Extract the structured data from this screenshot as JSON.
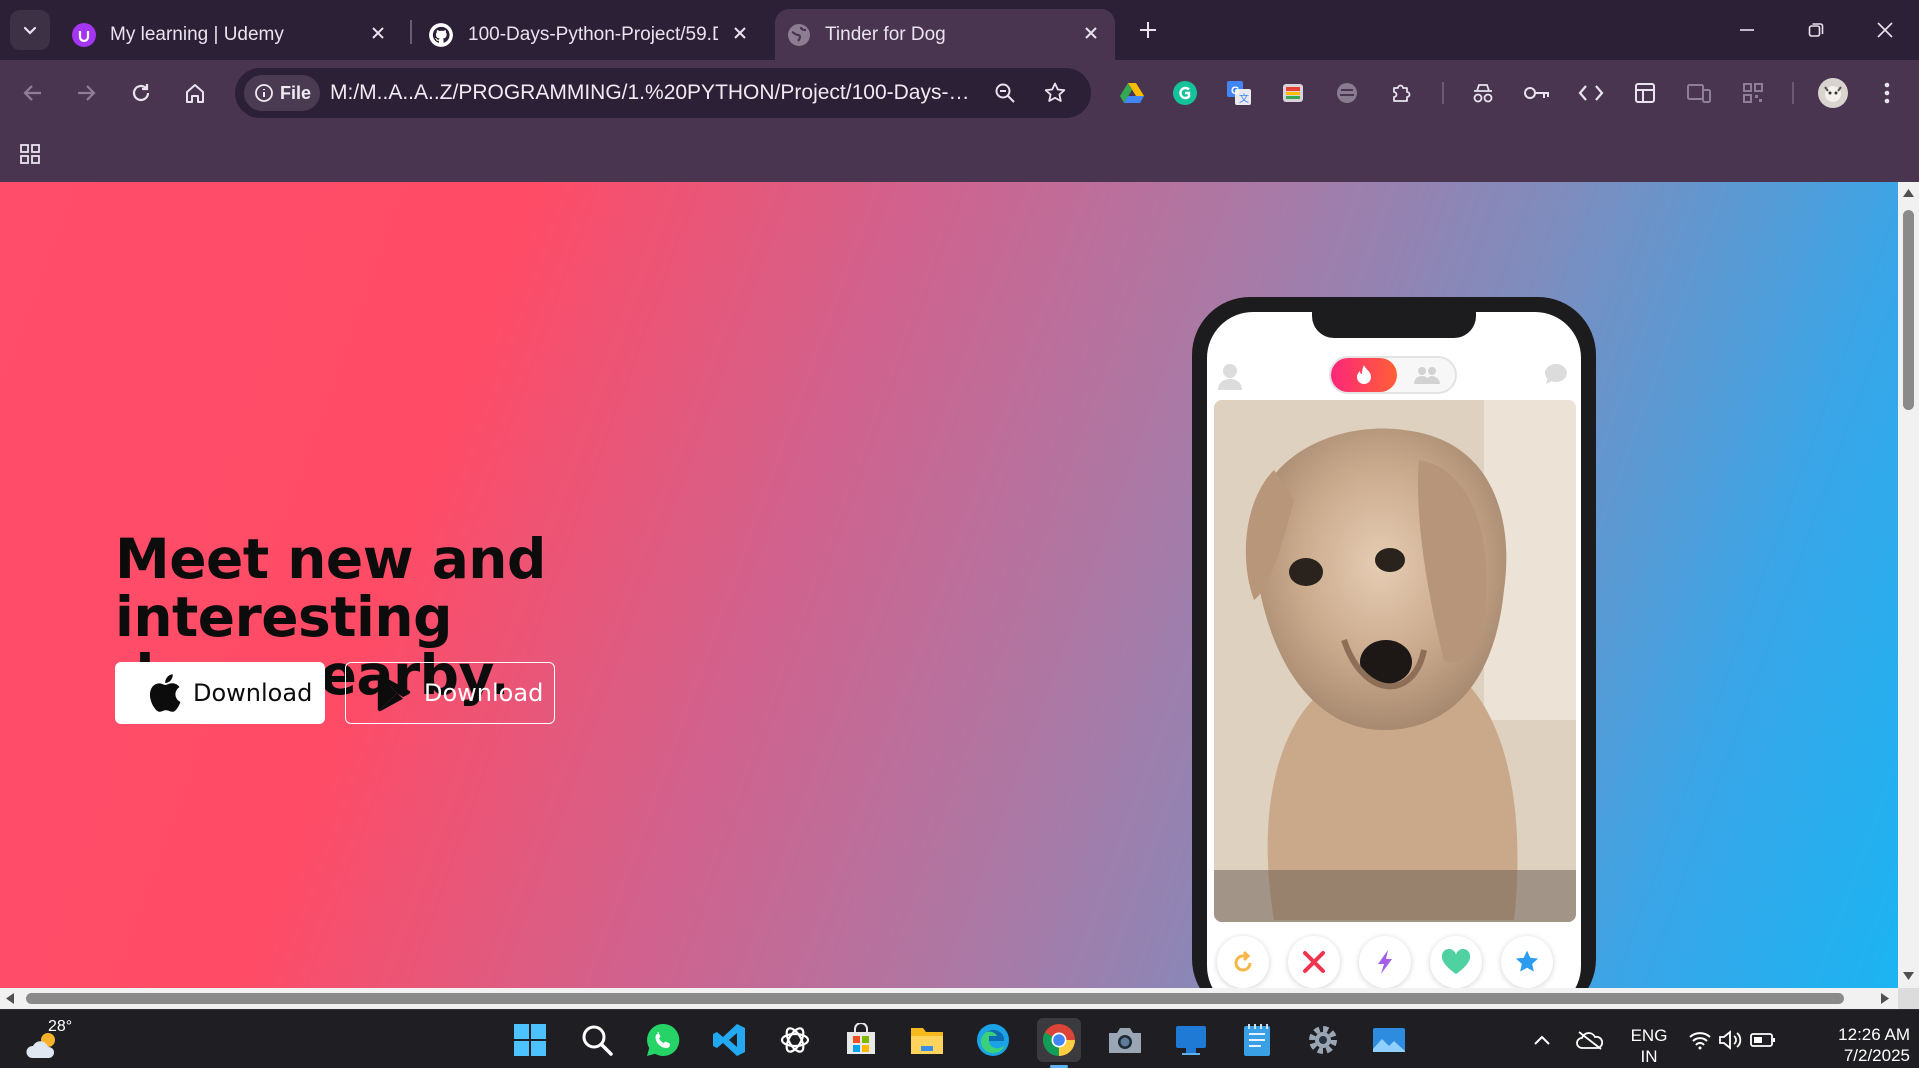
{
  "browser": {
    "tabs": [
      {
        "title": "My learning | Udemy",
        "icon": "udemy-icon",
        "active": false
      },
      {
        "title": "100-Days-Python-Project/59.Da",
        "icon": "github-icon",
        "active": false
      },
      {
        "title": "Tinder for Dog",
        "icon": "globe-icon",
        "active": true
      }
    ],
    "address": {
      "scheme_label": "File",
      "url": "M:/M..A..A..Z/PROGRAMMING/1.%20PYTHON/Project/100-Days-Pyt..."
    }
  },
  "page": {
    "headline_line1": "Meet new and interesting",
    "headline_line2": "dogs nearby.",
    "buttons": [
      {
        "label": "Download",
        "icon": "apple-icon"
      },
      {
        "label": "Download",
        "icon": "google-play-icon"
      }
    ]
  },
  "taskbar": {
    "weather_temp": "28°",
    "language_line1": "ENG",
    "language_line2": "IN",
    "time": "12:26 AM",
    "date": "7/2/2025"
  },
  "colors": {
    "chrome_dark": "#2b2036",
    "chrome_toolbar": "#4a3550",
    "gradient_red": "#ff4b66",
    "gradient_blue": "#1cb4f2",
    "tinder_pink": "#fd267a"
  }
}
